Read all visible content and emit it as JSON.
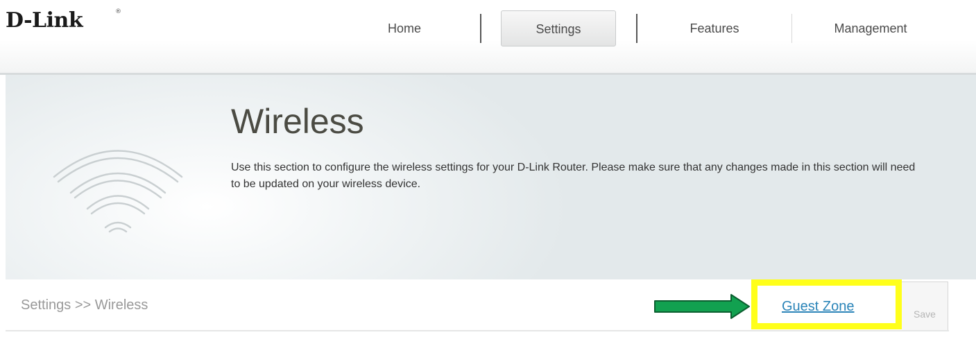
{
  "header": {
    "logo_text": "D-Link",
    "logo_mark": "®",
    "nav": [
      {
        "label": "Home"
      },
      {
        "label": "Settings",
        "active": true
      },
      {
        "label": "Features"
      },
      {
        "label": "Management"
      }
    ]
  },
  "banner": {
    "icon": "wifi-icon",
    "title": "Wireless",
    "description": "Use this section to configure the wireless settings for your D-Link Router. Please make sure that any changes made in this section will need to be updated on your wireless device."
  },
  "breadcrumb": {
    "text": "Settings >> Wireless"
  },
  "actions": {
    "guest_zone_label": "Guest Zone",
    "save_label": "Save",
    "annotation_arrow_icon": "right-arrow-icon",
    "arrow_color": "#12a150",
    "highlight_color": "#ffff1a",
    "link_color": "#2a84b8"
  }
}
